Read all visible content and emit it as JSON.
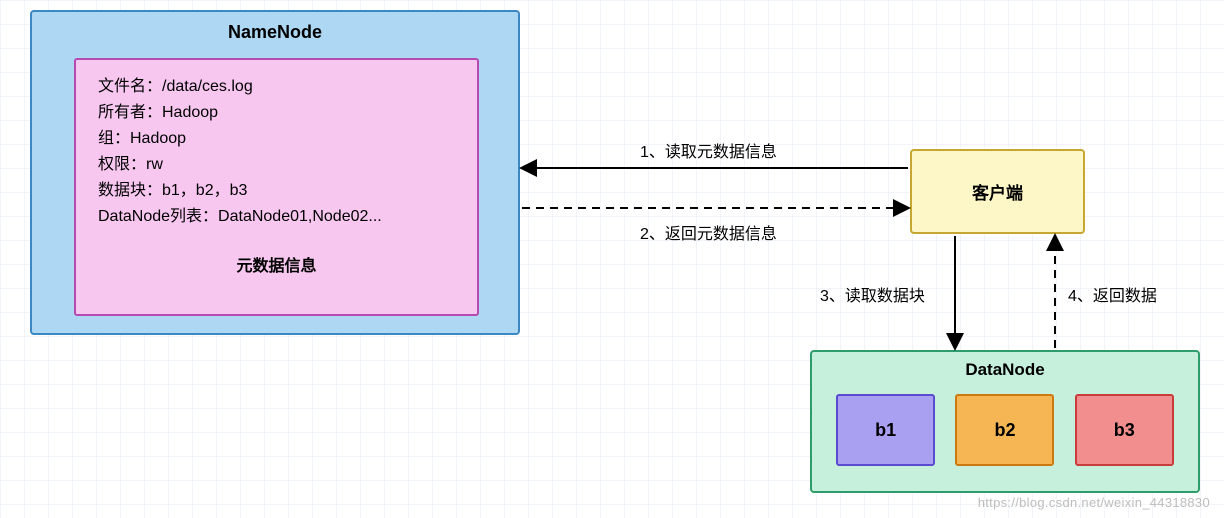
{
  "namenode": {
    "title": "NameNode",
    "meta": {
      "filename": "文件名：/data/ces.log",
      "owner": "所有者：Hadoop",
      "group": "组：Hadoop",
      "perm": "权限：rw",
      "blocks": "数据块：b1，b2，b3",
      "dnlist": "DataNode列表：DataNode01,Node02...",
      "footer": "元数据信息"
    }
  },
  "client": {
    "label": "客户端"
  },
  "datanode": {
    "title": "DataNode",
    "blocks": [
      "b1",
      "b2",
      "b3"
    ]
  },
  "arrows": {
    "a1": "1、读取元数据信息",
    "a2": "2、返回元数据信息",
    "a3": "3、读取数据块",
    "a4": "4、返回数据"
  },
  "watermark": "https://blog.csdn.net/weixin_44318830"
}
